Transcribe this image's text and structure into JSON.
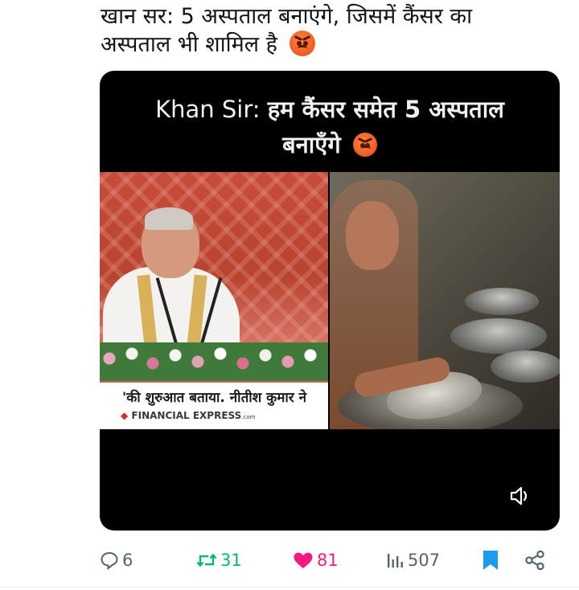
{
  "tweet": {
    "text_line1": "खान सर: 5 अस्पताल बनाएंगे, जिसमें कैंसर का",
    "text_line2": "अस्पताल भी शामिल है",
    "emoji": "angry-face-emoji"
  },
  "video": {
    "caption_prefix": "Khan Sir:",
    "caption_hindi_line1": "हम कैंसर समेत 5 अस्पताल",
    "caption_hindi_line2": "बनाएँगे",
    "left_frame": {
      "ticker_text": "'की शुरुआत बताया. नीतीश कुमार ने",
      "brand_name": "FINANCIAL EXPRESS",
      "brand_suffix": ".com"
    },
    "controls": {
      "volume_icon": "volume-icon"
    }
  },
  "actions": {
    "reply_count": "6",
    "retweet_count": "31",
    "like_count": "81",
    "views_count": "507",
    "colors": {
      "retweet": "#00ba7c",
      "like": "#f91880",
      "bookmark": "#1d9bf0",
      "muted": "#536471"
    }
  }
}
